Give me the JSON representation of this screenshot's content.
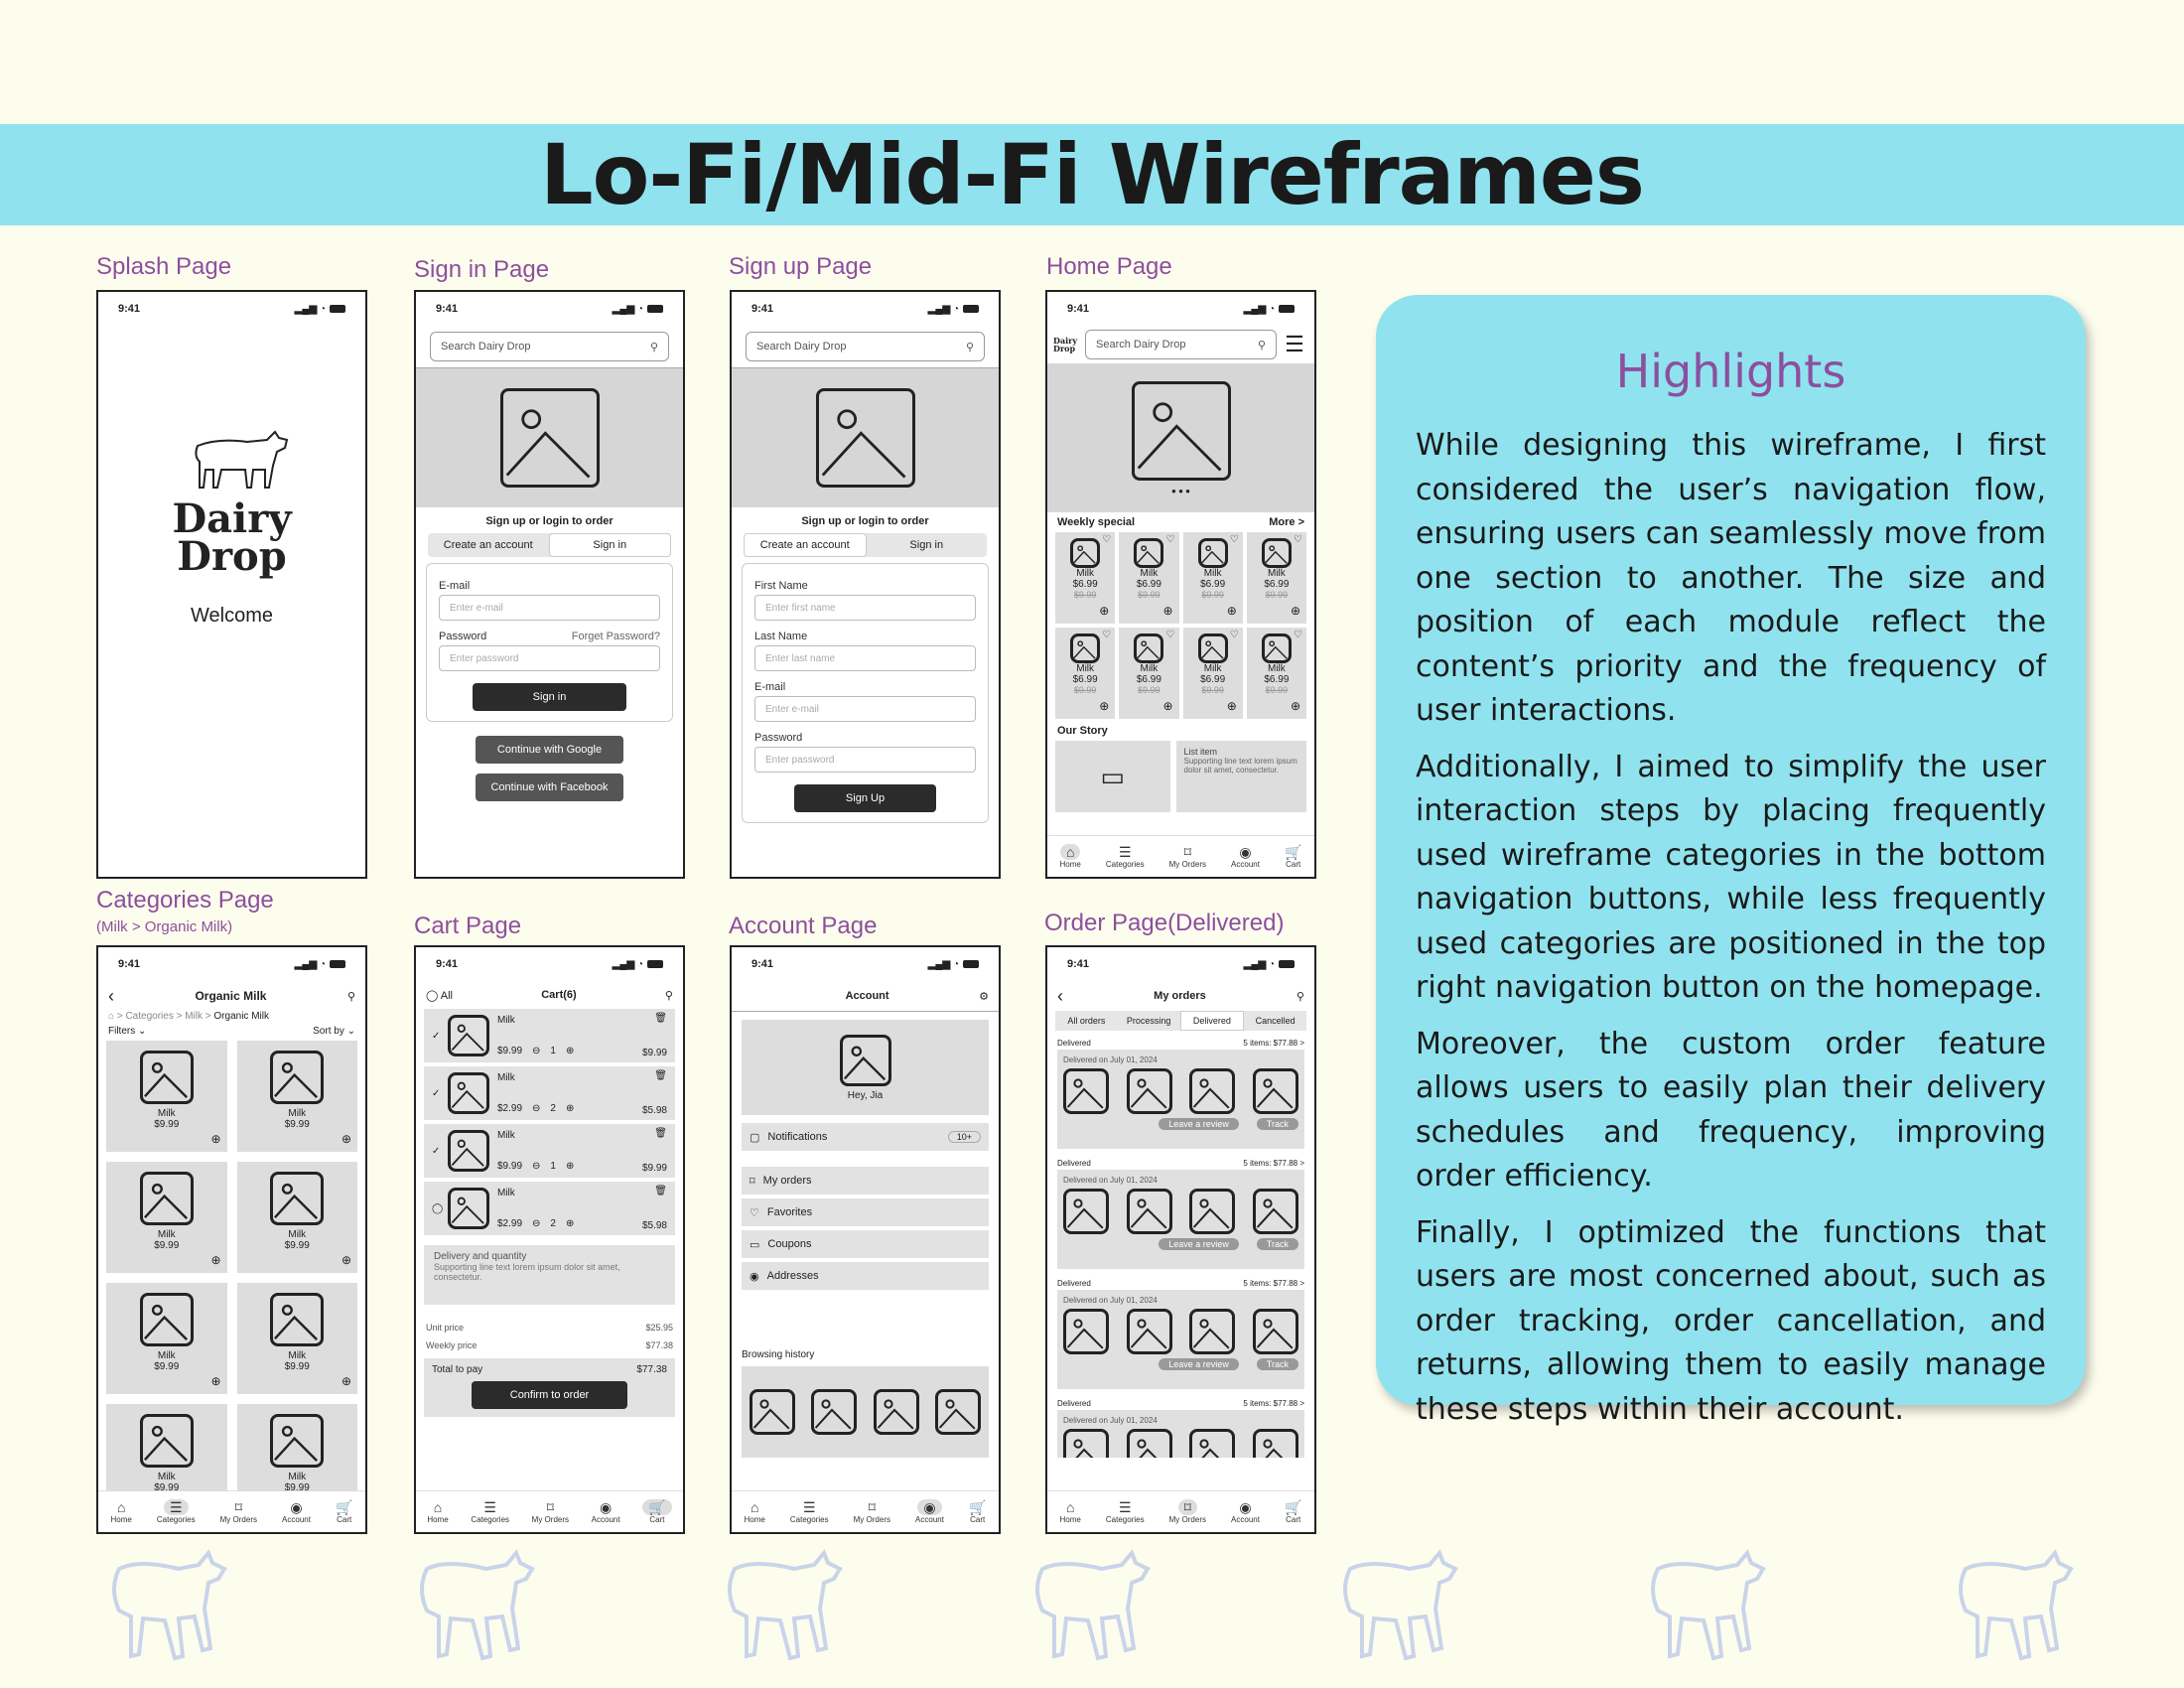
{
  "title": "Lo-Fi/Mid-Fi Wireframes",
  "labels": {
    "splash": "Splash Page",
    "signin": "Sign in Page",
    "signup": "Sign up Page",
    "home": "Home Page",
    "categories": "Categories Page",
    "categories_sub": "(Milk > Organic Milk)",
    "cart": "Cart Page",
    "account": "Account Page",
    "order": "Order Page(Delivered)"
  },
  "status_time": "9:41",
  "search_placeholder": "Search Dairy Drop",
  "splash": {
    "brand_line1": "Dairy",
    "brand_line2": "Drop",
    "welcome": "Welcome"
  },
  "signin": {
    "heading": "Sign up or login to order",
    "tab_create": "Create an account",
    "tab_signin": "Sign in",
    "email_label": "E-mail",
    "email_placeholder": "Enter e-mail",
    "password_label": "Password",
    "forgot": "Forget Password?",
    "password_placeholder": "Enter password",
    "signin_btn": "Sign in",
    "google_btn": "Continue with Google",
    "facebook_btn": "Continue with Facebook"
  },
  "signup": {
    "heading": "Sign up or login to order",
    "tab_create": "Create an account",
    "tab_signin": "Sign in",
    "first_label": "First Name",
    "first_placeholder": "Enter first name",
    "last_label": "Last Name",
    "last_placeholder": "Enter last name",
    "email_label": "E-mail",
    "email_placeholder": "Enter e-mail",
    "password_label": "Password",
    "password_placeholder": "Enter password",
    "signup_btn": "Sign Up"
  },
  "home": {
    "logo_text": "Dairy Drop",
    "weekly": "Weekly special",
    "more": "More >",
    "product_name": "Milk",
    "price": "$6.99",
    "old_price": "$9.99",
    "our_story": "Our Story",
    "list_item": "List item",
    "list_support": "Supporting line text lorem ipsum dolor sit amet, consectetur."
  },
  "nav": {
    "home": "Home",
    "categories": "Categories",
    "orders": "My Orders",
    "account": "Account",
    "cart": "Cart"
  },
  "categories": {
    "title": "Organic Milk",
    "crumb1": "Categories",
    "crumb2": "Milk",
    "crumb3": "Organic Milk",
    "filters": "Filters",
    "sortby": "Sort by",
    "product_name": "Milk",
    "price": "$9.99"
  },
  "cart": {
    "all": "All",
    "title": "Cart(6)",
    "items": [
      {
        "name": "Milk",
        "price": "$9.99",
        "qty": "1",
        "total": "$9.99"
      },
      {
        "name": "Milk",
        "price": "$2.99",
        "qty": "2",
        "total": "$5.98"
      },
      {
        "name": "Milk",
        "price": "$9.99",
        "qty": "1",
        "total": "$9.99"
      },
      {
        "name": "Milk",
        "price": "$2.99",
        "qty": "2",
        "total": "$5.98"
      }
    ],
    "delivery_title": "Delivery and quantity",
    "delivery_sub": "Supporting line text lorem ipsum dolor sit amet, consectetur.",
    "unit_price": "Unit price",
    "unit_value": "$25.95",
    "weekly_price": "Weekly price",
    "weekly_value": "$77.38",
    "total": "Total to pay",
    "total_value": "$77.38",
    "confirm": "Confirm to order"
  },
  "account": {
    "title": "Account",
    "greeting": "Hey, Jia",
    "notifications": "Notifications",
    "notif_count": "10+",
    "orders": "My orders",
    "favorites": "Favorites",
    "coupons": "Coupons",
    "addresses": "Addresses",
    "history": "Browsing history"
  },
  "order": {
    "title": "My orders",
    "tabs": [
      "All orders",
      "Processing",
      "Delivered",
      "Cancelled"
    ],
    "status": "Delivered",
    "summary": "5 items: $77.88 >",
    "date": "Delivered on July 01, 2024",
    "review": "Leave a review",
    "track": "Track"
  },
  "highlights": {
    "title": "Highlights",
    "p1": "While designing this wireframe, I first considered the user’s navigation flow, ensuring users can seamlessly move from one section to another. The size and position of each module reflect the content’s priority and the frequency of user interactions.",
    "p2": "Additionally, I aimed to simplify the user interaction steps by placing frequently used wireframe categories in the bottom navigation buttons, while less frequently used categories are positioned in the top right navigation button on the homepage.",
    "p3": "Moreover, the custom order feature allows users to easily plan their delivery schedules and frequency, improving order efficiency.",
    "p4": "Finally, I optimized the functions that users are most concerned about, such as order tracking, order cancellation, and returns, allowing them to easily manage these steps within their account."
  },
  "colors": {
    "banner": "#90e3ee",
    "accent": "#8c4f9e",
    "background": "#fdfdee"
  }
}
